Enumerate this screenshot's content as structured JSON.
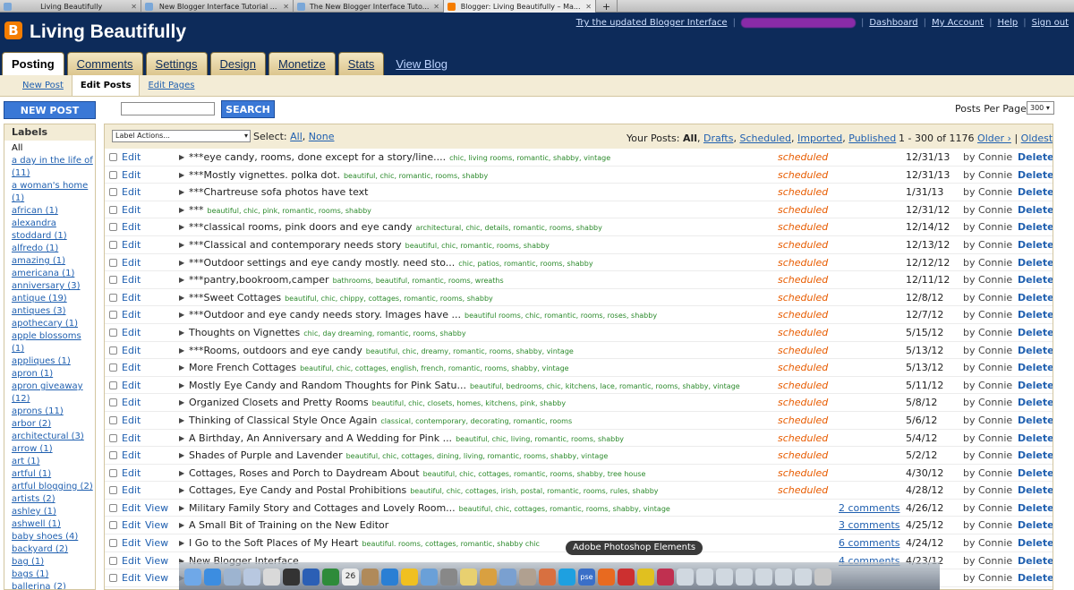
{
  "browser_tabs": [
    {
      "label": "Living Beautifully",
      "active": false
    },
    {
      "label": "New Blogger Interface Tutorial ...",
      "active": false
    },
    {
      "label": "The New Blogger Interface Tuto...",
      "active": false
    },
    {
      "label": "Blogger: Living Beautifully – Ma...",
      "active": true
    }
  ],
  "header": {
    "logo": "B",
    "blog_title": "Living Beautifully",
    "links": [
      "Try the updated Blogger Interface",
      "Dashboard",
      "My Account",
      "Help",
      "Sign out"
    ]
  },
  "main_tabs": [
    "Posting",
    "Comments",
    "Settings",
    "Design",
    "Monetize",
    "Stats"
  ],
  "view_blog": "View Blog",
  "sub_tabs": [
    "New Post",
    "Edit Posts",
    "Edit Pages"
  ],
  "toolbar": {
    "new_post": "NEW POST",
    "search": "SEARCH",
    "posts_per_page_label": "Posts Per Page",
    "posts_per_page_value": "300"
  },
  "labels": {
    "heading": "Labels",
    "items": [
      "All",
      "a day in the life of (11)",
      "a woman's home (1)",
      "african (1)",
      "alexandra stoddard (1)",
      "alfredo (1)",
      "amazing (1)",
      "americana (1)",
      "anniversary (3)",
      "antique (19)",
      "antiques (3)",
      "apothecary (1)",
      "apple blossoms (1)",
      "appliques (1)",
      "apron (1)",
      "apron giveaway (12)",
      "aprons (11)",
      "arbor (2)",
      "architectural (3)",
      "arrow (1)",
      "art (1)",
      "artful (1)",
      "artful blogging (2)",
      "artists (2)",
      "ashley (1)",
      "ashwell (1)",
      "baby shoes (4)",
      "backyard (2)",
      "bag (1)",
      "bags (1)",
      "ballerina (2)"
    ]
  },
  "posts_header": {
    "label_actions": "Label Actions...",
    "select_label": "Select:",
    "select_all": "All",
    "select_none": "None",
    "your_posts_label": "Your Posts:",
    "filter_all": "All",
    "filter_drafts": "Drafts",
    "filter_scheduled": "Scheduled",
    "filter_imported": "Imported",
    "filter_published": "Published",
    "range": "1 - 300 of 1176",
    "older": "Older ›",
    "oldest": "Oldest »"
  },
  "row_labels": {
    "edit": "Edit",
    "view": "View",
    "delete": "Delete"
  },
  "posts": [
    {
      "title": "***eye candy, rooms, done except for a story/line....",
      "tags": "chic, living rooms, romantic, shabby, vintage",
      "status": "scheduled",
      "comments": "",
      "date": "12/31/13",
      "by": "by Connie"
    },
    {
      "title": "***Mostly vignettes. polka dot.",
      "tags": "beautiful, chic, romantic, rooms, shabby",
      "status": "scheduled",
      "comments": "",
      "date": "12/31/13",
      "by": "by Connie"
    },
    {
      "title": "***Chartreuse sofa photos have text",
      "tags": "",
      "status": "scheduled",
      "comments": "",
      "date": "1/31/13",
      "by": "by Connie"
    },
    {
      "title": "***",
      "tags": "beautiful, chic, pink, romantic, rooms, shabby",
      "status": "scheduled",
      "comments": "",
      "date": "12/31/12",
      "by": "by Connie"
    },
    {
      "title": "***classical rooms, pink doors and eye candy",
      "tags": "architectural, chic, details, romantic, rooms, shabby",
      "status": "scheduled",
      "comments": "",
      "date": "12/14/12",
      "by": "by Connie"
    },
    {
      "title": "***Classical and contemporary needs story",
      "tags": "beautiful, chic, romantic, rooms, shabby",
      "status": "scheduled",
      "comments": "",
      "date": "12/13/12",
      "by": "by Connie"
    },
    {
      "title": "***Outdoor settings and eye candy mostly. need sto...",
      "tags": "chic, patios, romantic, rooms, shabby",
      "status": "scheduled",
      "comments": "",
      "date": "12/12/12",
      "by": "by Connie"
    },
    {
      "title": "***pantry,bookroom,camper",
      "tags": "bathrooms, beautiful, romantic, rooms, wreaths",
      "status": "scheduled",
      "comments": "",
      "date": "12/11/12",
      "by": "by Connie"
    },
    {
      "title": "***Sweet Cottages",
      "tags": "beautiful, chic, chippy, cottages, romantic, rooms, shabby",
      "status": "scheduled",
      "comments": "",
      "date": "12/8/12",
      "by": "by Connie"
    },
    {
      "title": "***Outdoor and eye candy needs story. Images have ...",
      "tags": "beautiful rooms, chic, romantic, rooms, roses, shabby",
      "status": "scheduled",
      "comments": "",
      "date": "12/7/12",
      "by": "by Connie"
    },
    {
      "title": "Thoughts on Vignettes",
      "tags": "chic, day dreaming, romantic, rooms, shabby",
      "status": "scheduled",
      "comments": "",
      "date": "5/15/12",
      "by": "by Connie"
    },
    {
      "title": "***Rooms, outdoors and eye candy",
      "tags": "beautiful, chic, dreamy, romantic, rooms, shabby, vintage",
      "status": "scheduled",
      "comments": "",
      "date": "5/13/12",
      "by": "by Connie"
    },
    {
      "title": "More French Cottages",
      "tags": "beautiful, chic, cottages, english, french, romantic, rooms, shabby, vintage",
      "status": "scheduled",
      "comments": "",
      "date": "5/13/12",
      "by": "by Connie"
    },
    {
      "title": "Mostly Eye Candy and Random Thoughts for Pink Satu...",
      "tags": "beautiful, bedrooms, chic, kitchens, lace, romantic, rooms, shabby, vintage",
      "status": "scheduled",
      "comments": "",
      "date": "5/11/12",
      "by": "by Connie"
    },
    {
      "title": "Organized Closets and Pretty Rooms",
      "tags": "beautiful, chic, closets, homes, kitchens, pink, shabby",
      "status": "scheduled",
      "comments": "",
      "date": "5/8/12",
      "by": "by Connie"
    },
    {
      "title": "Thinking of Classical Style Once Again",
      "tags": "classical, contemporary, decorating, romantic, rooms",
      "status": "scheduled",
      "comments": "",
      "date": "5/6/12",
      "by": "by Connie"
    },
    {
      "title": "A Birthday, An Anniversary and A Wedding for Pink ...",
      "tags": "beautiful, chic, living, romantic, rooms, shabby",
      "status": "scheduled",
      "comments": "",
      "date": "5/4/12",
      "by": "by Connie"
    },
    {
      "title": "Shades of Purple and Lavender",
      "tags": "beautiful, chic, cottages, dining, living, romantic, rooms, shabby, vintage",
      "status": "scheduled",
      "comments": "",
      "date": "5/2/12",
      "by": "by Connie"
    },
    {
      "title": "Cottages, Roses and Porch to Daydream About",
      "tags": "beautiful, chic, cottages, romantic, rooms, shabby, tree house",
      "status": "scheduled",
      "comments": "",
      "date": "4/30/12",
      "by": "by Connie"
    },
    {
      "title": "Cottages, Eye Candy and Postal Prohibitions",
      "tags": "beautiful, chic, cottages, irish, postal, romantic, rooms, rules, shabby",
      "status": "scheduled",
      "comments": "",
      "date": "4/28/12",
      "by": "by Connie"
    },
    {
      "title": "Military Family Story and Cottages and Lovely Room...",
      "tags": "beautiful, chic, cottages, romantic, rooms, shabby, vintage",
      "status": "",
      "comments": "2 comments",
      "date": "4/26/12",
      "by": "by Connie"
    },
    {
      "title": "A Small Bit of Training on the New Editor",
      "tags": "",
      "status": "",
      "comments": "3 comments",
      "date": "4/25/12",
      "by": "by Connie"
    },
    {
      "title": "I Go to the Soft Places of My Heart",
      "tags": "beautiful. rooms, cottages, romantic, shabby chic",
      "status": "",
      "comments": "6 comments",
      "date": "4/24/12",
      "by": "by Connie"
    },
    {
      "title": "New Blogger Interface",
      "tags": "",
      "status": "",
      "comments": "4 comments",
      "date": "4/23/12",
      "by": "by Connie"
    },
    {
      "title": "",
      "tags": "",
      "status": "",
      "comments": "",
      "date": "",
      "by": "by Connie"
    }
  ],
  "dock": {
    "tooltip": "Adobe Photoshop Elements",
    "calendar_day": "26",
    "pse_label": "pse"
  }
}
